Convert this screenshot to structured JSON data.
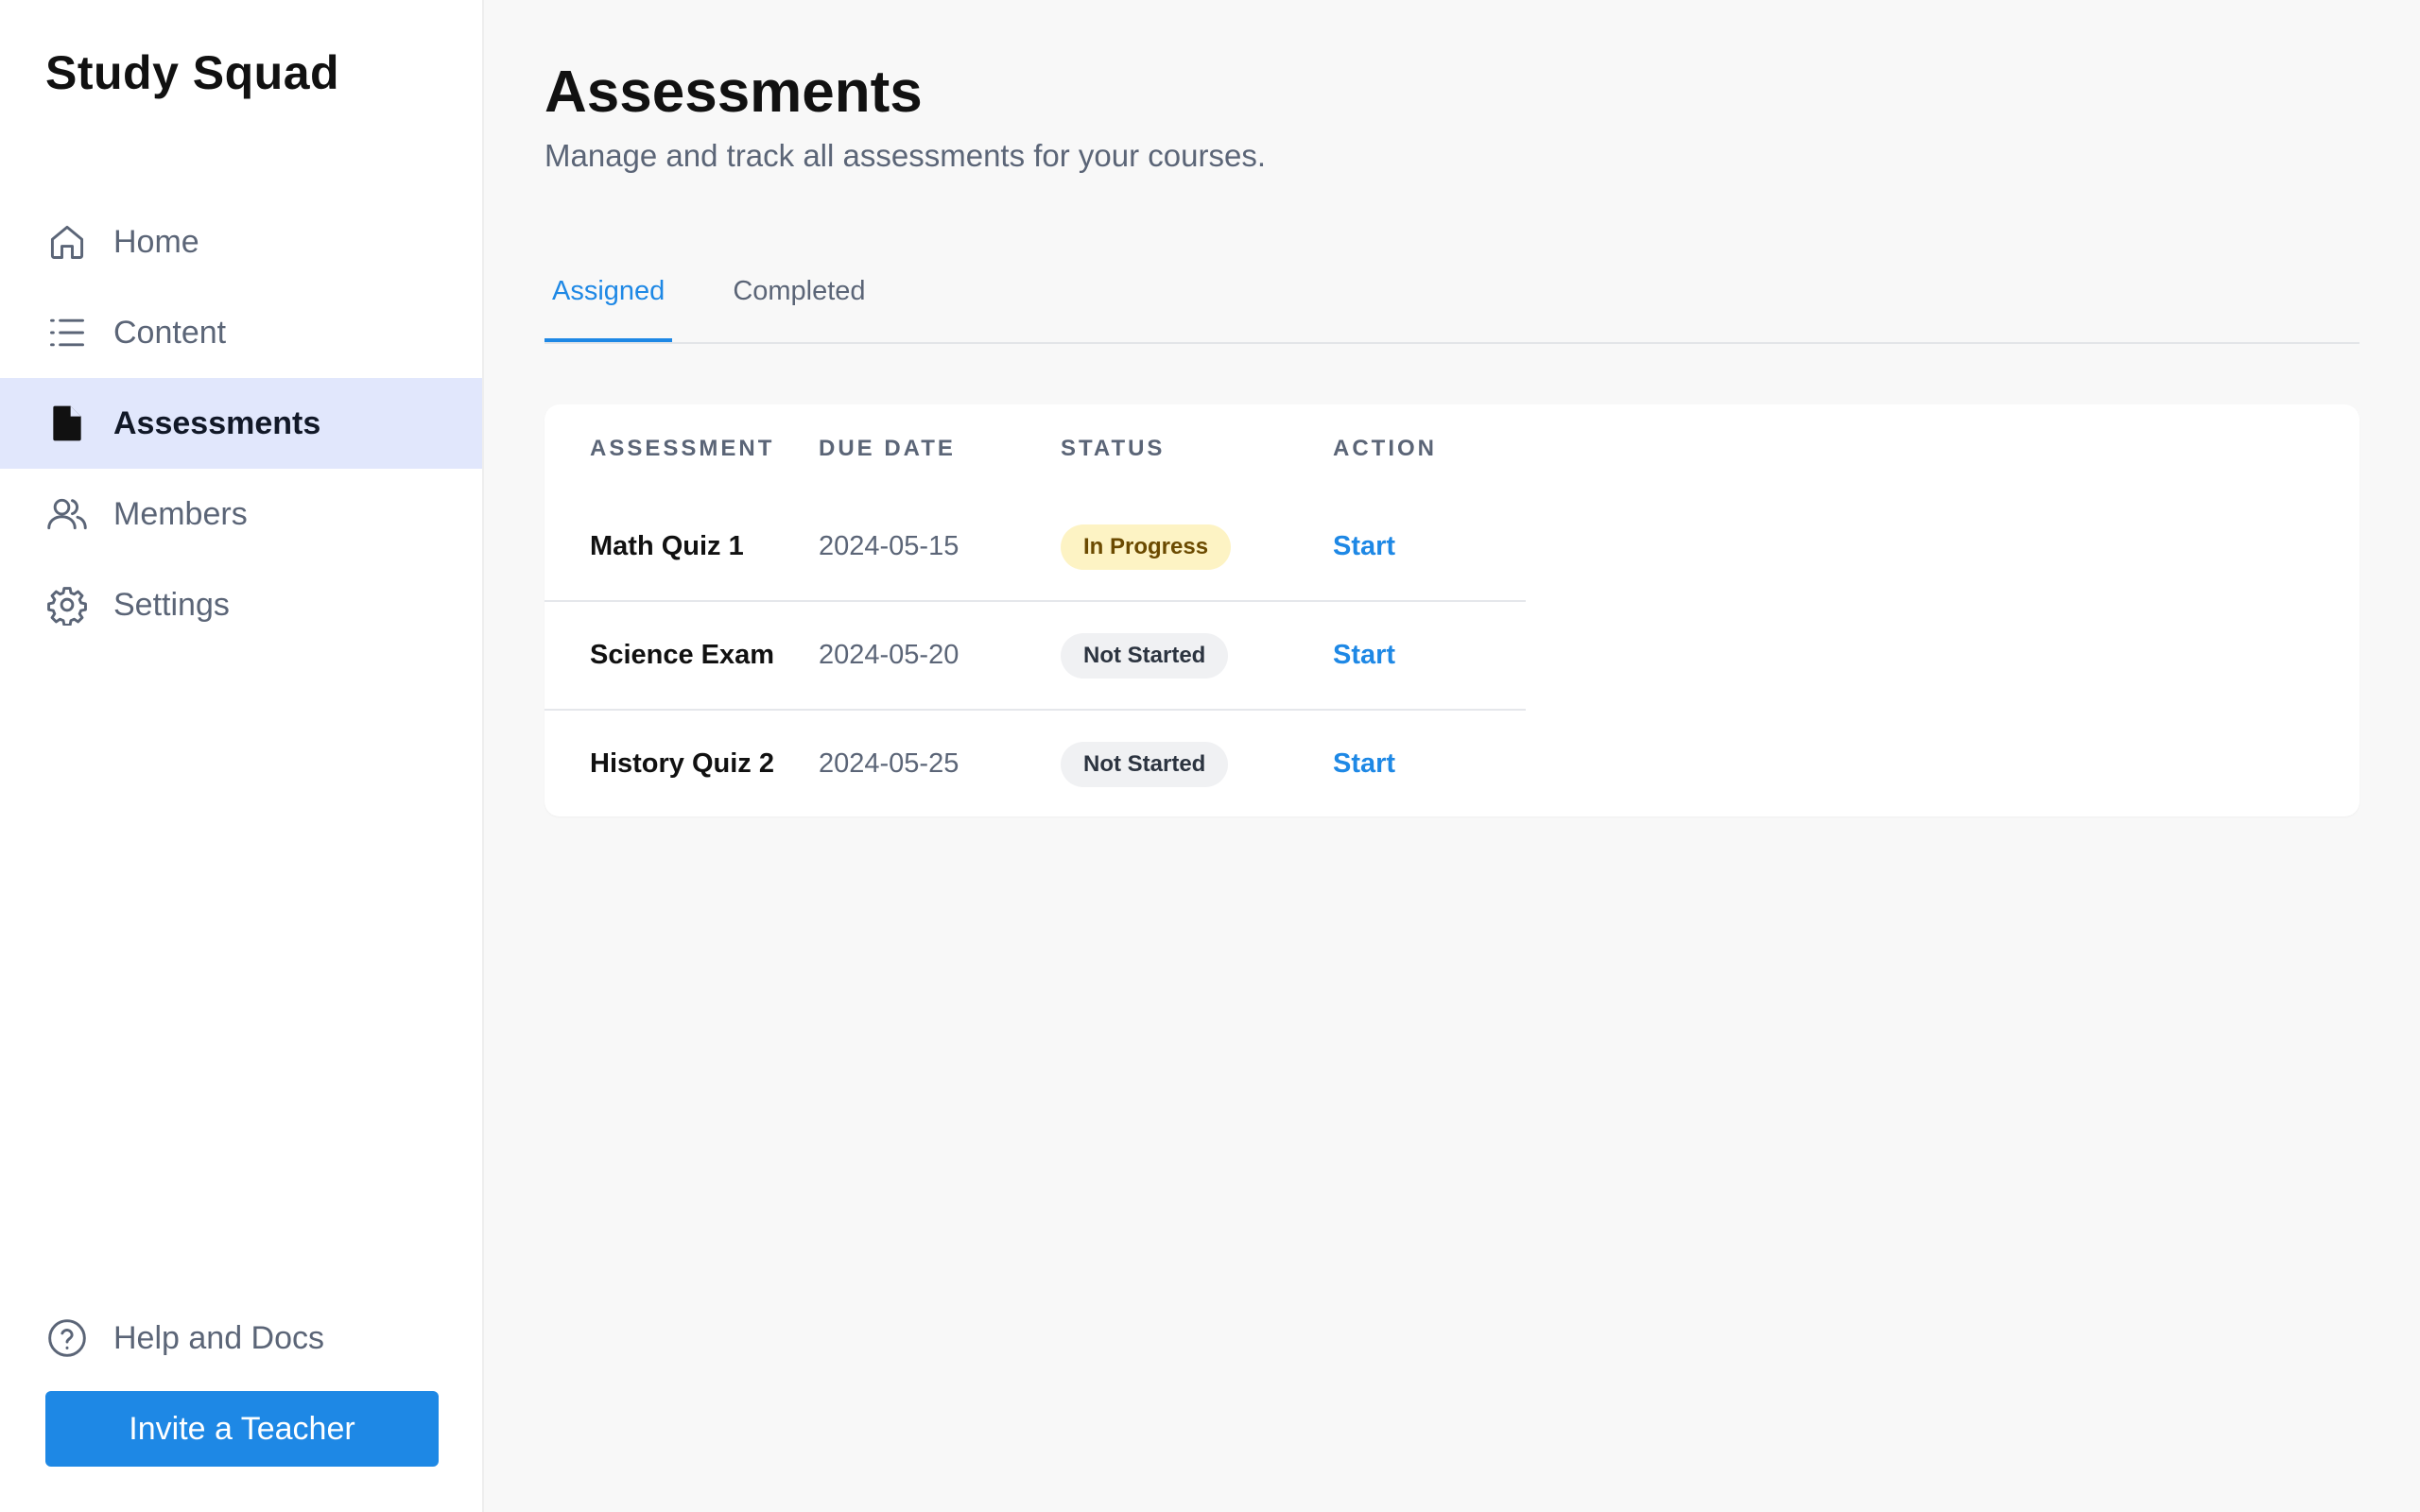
{
  "app": {
    "brand": "Study Squad"
  },
  "sidebar": {
    "items": [
      {
        "label": "Home",
        "icon": "home-icon"
      },
      {
        "label": "Content",
        "icon": "list-icon"
      },
      {
        "label": "Assessments",
        "icon": "document-icon",
        "active": true
      },
      {
        "label": "Members",
        "icon": "users-icon"
      },
      {
        "label": "Settings",
        "icon": "gear-icon"
      }
    ],
    "help_label": "Help and Docs",
    "invite_label": "Invite a Teacher"
  },
  "header": {
    "title": "Assessments",
    "subtitle": "Manage and track all assessments for your courses."
  },
  "tabs": [
    {
      "label": "Assigned",
      "active": true
    },
    {
      "label": "Completed",
      "active": false
    }
  ],
  "table": {
    "columns": [
      "ASSESSMENT",
      "DUE DATE",
      "STATUS",
      "ACTION"
    ],
    "rows": [
      {
        "name": "Math Quiz 1",
        "due": "2024-05-15",
        "status": "In Progress",
        "action": "Start"
      },
      {
        "name": "Science Exam",
        "due": "2024-05-20",
        "status": "Not Started",
        "action": "Start"
      },
      {
        "name": "History Quiz 2",
        "due": "2024-05-25",
        "status": "Not Started",
        "action": "Start"
      }
    ]
  },
  "colors": {
    "accent": "#1e88e5",
    "active_nav_bg": "#e1e7fc",
    "in_progress_bg": "#fdf3c4",
    "not_started_bg": "#f0f1f3"
  }
}
